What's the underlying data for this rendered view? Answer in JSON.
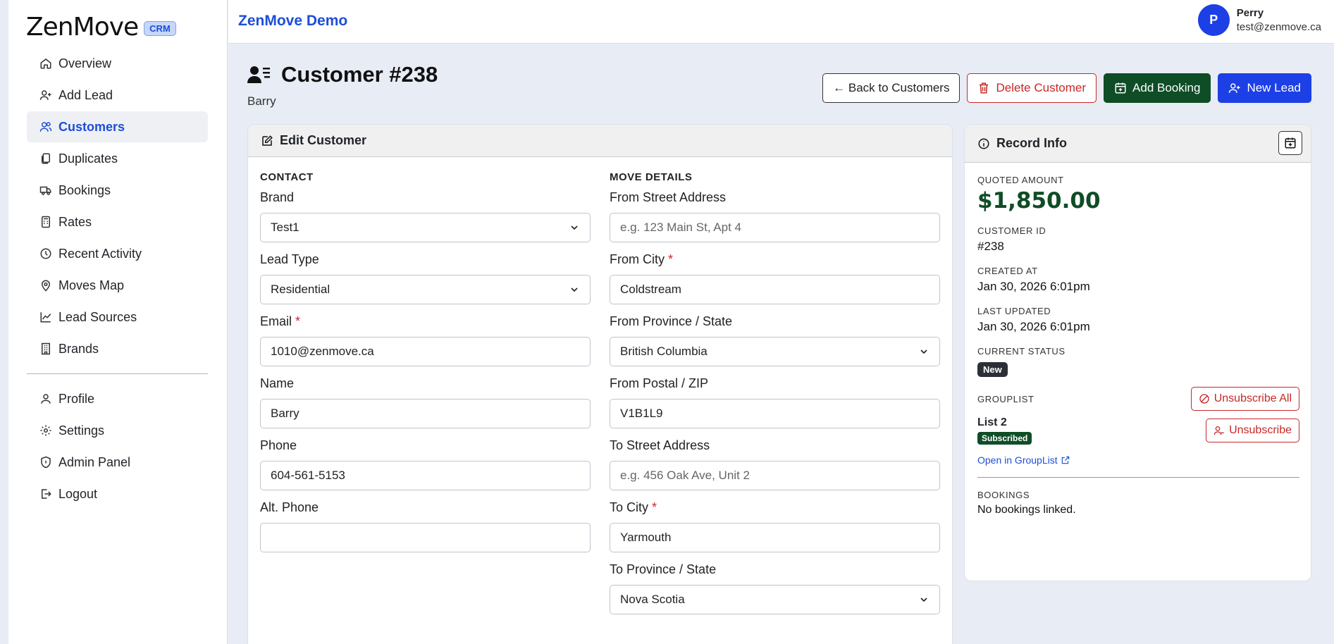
{
  "brand": {
    "name": "ZenMove",
    "badge": "CRM"
  },
  "nav": {
    "items": [
      {
        "label": "Overview",
        "icon": "home-icon"
      },
      {
        "label": "Add Lead",
        "icon": "user-plus-icon"
      },
      {
        "label": "Customers",
        "icon": "users-icon",
        "active": true
      },
      {
        "label": "Duplicates",
        "icon": "copy-icon"
      },
      {
        "label": "Bookings",
        "icon": "truck-icon"
      },
      {
        "label": "Rates",
        "icon": "calculator-icon"
      },
      {
        "label": "Recent Activity",
        "icon": "clock-icon"
      },
      {
        "label": "Moves Map",
        "icon": "map-pin-icon"
      },
      {
        "label": "Lead Sources",
        "icon": "chart-line-icon"
      },
      {
        "label": "Brands",
        "icon": "building-icon"
      }
    ],
    "secondary": [
      {
        "label": "Profile",
        "icon": "person-icon"
      },
      {
        "label": "Settings",
        "icon": "gear-icon"
      },
      {
        "label": "Admin Panel",
        "icon": "shield-icon"
      },
      {
        "label": "Logout",
        "icon": "logout-icon"
      }
    ]
  },
  "topbar": {
    "title": "ZenMove Demo",
    "user_initial": "P",
    "user_name": "Perry",
    "user_email": "test@zenmove.ca"
  },
  "page": {
    "title": "Customer #238",
    "subtitle": "Barry"
  },
  "actions": {
    "back": "← Back to Customers",
    "delete": "Delete Customer",
    "add_booking": "Add Booking",
    "new_lead": "New Lead"
  },
  "edit": {
    "title": "Edit Customer",
    "contact_title": "CONTACT",
    "move_title": "MOVE DETAILS",
    "brand": {
      "label": "Brand",
      "value": "Test1"
    },
    "lead_type": {
      "label": "Lead Type",
      "value": "Residential"
    },
    "email": {
      "label": "Email",
      "value": "1010@zenmove.ca"
    },
    "name": {
      "label": "Name",
      "value": "Barry"
    },
    "phone": {
      "label": "Phone",
      "value": "604-561-5153"
    },
    "alt_phone": {
      "label": "Alt. Phone",
      "value": ""
    },
    "from_street": {
      "label": "From Street Address",
      "placeholder": "e.g. 123 Main St, Apt 4"
    },
    "from_city": {
      "label": "From City",
      "value": "Coldstream"
    },
    "from_province": {
      "label": "From Province / State",
      "value": "British Columbia"
    },
    "from_postal": {
      "label": "From Postal / ZIP",
      "value": "V1B1L9"
    },
    "to_street": {
      "label": "To Street Address",
      "placeholder": "e.g. 456 Oak Ave, Unit 2"
    },
    "to_city": {
      "label": "To City",
      "value": "Yarmouth"
    },
    "to_province": {
      "label": "To Province / State",
      "value": "Nova Scotia"
    },
    "required_mark": "*"
  },
  "record": {
    "title": "Record Info",
    "quoted_label": "QUOTED AMOUNT",
    "quoted_value": "$1,850.00",
    "id_label": "CUSTOMER ID",
    "id_value": "#238",
    "created_label": "CREATED AT",
    "created_value": "Jan 30, 2026 6:01pm",
    "updated_label": "LAST UPDATED",
    "updated_value": "Jan 30, 2026 6:01pm",
    "status_label": "CURRENT STATUS",
    "status_value": "New",
    "grouplist_label": "GROUPLIST",
    "unsubscribe_all": "Unsubscribe All",
    "list_name": "List 2",
    "list_status": "Subscribed",
    "unsubscribe": "Unsubscribe",
    "open_link": "Open in GroupList",
    "bookings_label": "BOOKINGS",
    "bookings_value": "No bookings linked."
  }
}
